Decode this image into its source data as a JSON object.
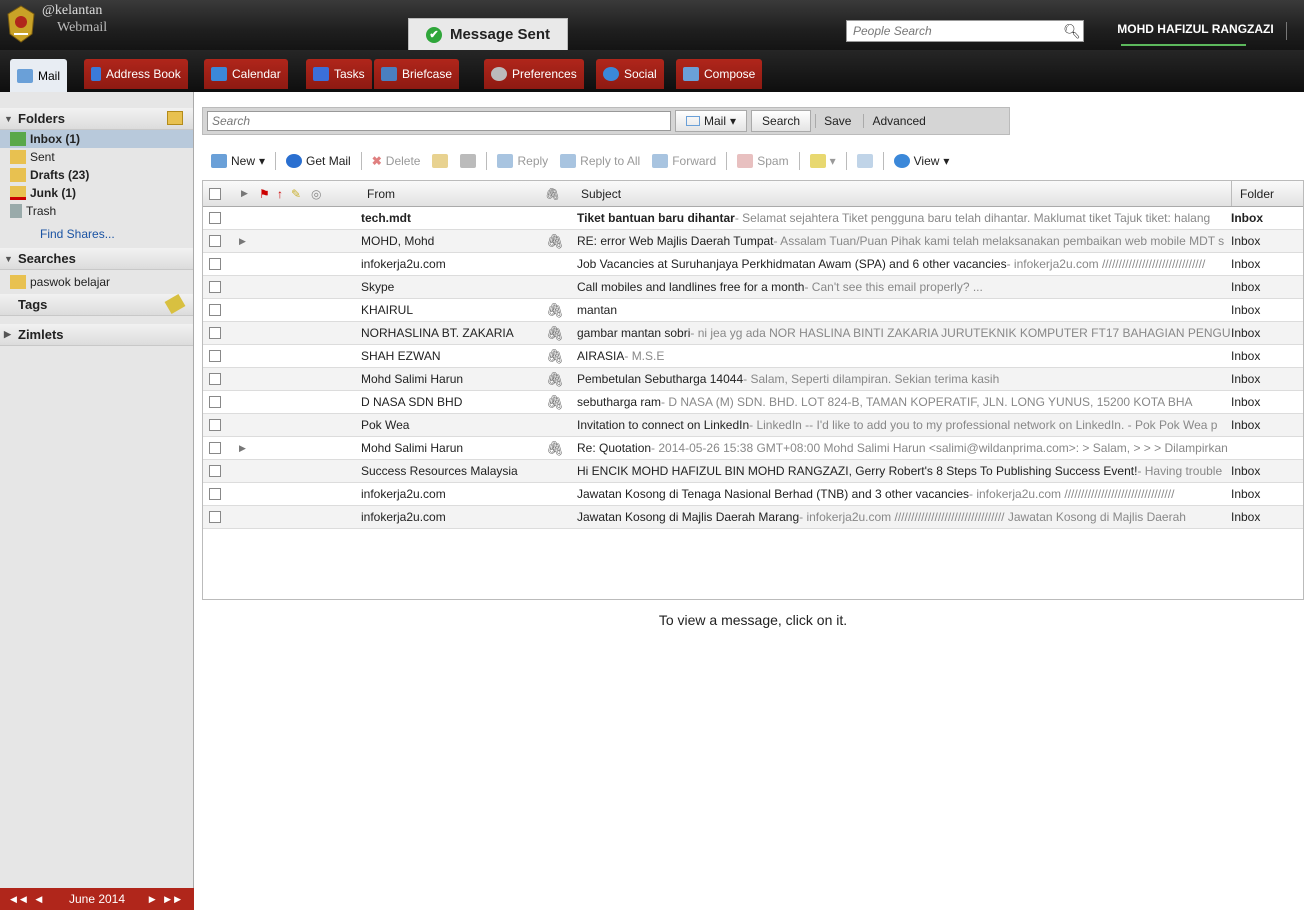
{
  "header": {
    "logo_line1": "@kelantan",
    "logo_line2": "Webmail",
    "toast": "Message Sent",
    "people_search_placeholder": "People Search",
    "user_name": "MOHD HAFIZUL RANGZAZI"
  },
  "tabs": [
    {
      "label": "Mail",
      "icon": "mail-icon",
      "color": "#6aa0d8"
    },
    {
      "label": "Address Book",
      "icon": "address-book-icon",
      "color": "#3b7ad9"
    },
    {
      "label": "Calendar",
      "icon": "calendar-icon",
      "color": "#3b88d9"
    },
    {
      "label": "Tasks",
      "icon": "tasks-icon",
      "color": "#3b6fd9"
    },
    {
      "label": "Briefcase",
      "icon": "briefcase-icon",
      "color": "#4a7fc0"
    },
    {
      "label": "Preferences",
      "icon": "preferences-icon",
      "color": "#bbbbbb"
    },
    {
      "label": "Social",
      "icon": "social-icon",
      "color": "#3b88d9"
    },
    {
      "label": "Compose",
      "icon": "compose-icon",
      "color": "#6aa0d8"
    }
  ],
  "sidebar": {
    "folders_title": "Folders",
    "folders": [
      {
        "label": "Inbox (1)",
        "icon": "inbox-icon",
        "bold": true,
        "selected": true
      },
      {
        "label": "Sent",
        "icon": "sent-icon",
        "bold": false,
        "selected": false
      },
      {
        "label": "Drafts (23)",
        "icon": "drafts-icon",
        "bold": true,
        "selected": false
      },
      {
        "label": "Junk (1)",
        "icon": "junk-icon",
        "bold": true,
        "selected": false
      },
      {
        "label": "Trash",
        "icon": "trash-icon",
        "bold": false,
        "selected": false
      }
    ],
    "find_shares": "Find Shares...",
    "searches_title": "Searches",
    "searches": [
      {
        "label": "paswok belajar"
      }
    ],
    "tags_title": "Tags",
    "zimlets_title": "Zimlets",
    "calendar_month": "June 2014"
  },
  "search": {
    "placeholder": "Search",
    "scope": "Mail",
    "search_btn": "Search",
    "save_btn": "Save",
    "advanced_btn": "Advanced"
  },
  "toolbar": {
    "new": "New",
    "get_mail": "Get Mail",
    "delete": "Delete",
    "reply": "Reply",
    "reply_all": "Reply to All",
    "forward": "Forward",
    "spam": "Spam",
    "view": "View"
  },
  "columns": {
    "from": "From",
    "subject": "Subject",
    "folder": "Folder"
  },
  "messages": [
    {
      "from": "tech.mdt",
      "subject": "Tiket bantuan baru dihantar",
      "fragment": " - Selamat sejahtera Tiket pengguna baru telah dihantar. Maklumat tiket Tajuk tiket: halang",
      "folder": "Inbox",
      "unread": true,
      "attach": false,
      "conv": false
    },
    {
      "from": "MOHD, Mohd",
      "subject": "RE: error Web Majlis Daerah Tumpat",
      "fragment": " - Assalam Tuan/Puan Pihak kami telah melaksanakan pembaikan web mobile MDT s",
      "folder": "Inbox",
      "unread": false,
      "attach": true,
      "conv": true
    },
    {
      "from": "infokerja2u.com",
      "subject": "Job Vacancies at Suruhanjaya Perkhidmatan Awam (SPA) and 6 other vacancies",
      "fragment": " - infokerja2u.com ///////////////////////////////",
      "folder": "Inbox",
      "unread": false,
      "attach": false,
      "conv": false
    },
    {
      "from": "Skype",
      "subject": "Call mobiles and landlines free for a month",
      "fragment": " - Can't see this email properly? ...",
      "folder": "Inbox",
      "unread": false,
      "attach": false,
      "conv": false
    },
    {
      "from": "KHAIRUL",
      "subject": "mantan",
      "fragment": "",
      "folder": "Inbox",
      "unread": false,
      "attach": true,
      "conv": false
    },
    {
      "from": "NORHASLINA BT. ZAKARIA",
      "subject": "gambar mantan sobri",
      "fragment": " - ni jea yg ada NOR HASLINA BINTI ZAKARIA JURUTEKNIK KOMPUTER FT17 BAHAGIAN PENGUR",
      "folder": "Inbox",
      "unread": false,
      "attach": true,
      "conv": false
    },
    {
      "from": "SHAH EZWAN",
      "subject": "AIRASIA",
      "fragment": " - M.S.E",
      "folder": "Inbox",
      "unread": false,
      "attach": true,
      "conv": false
    },
    {
      "from": "Mohd Salimi Harun",
      "subject": "Pembetulan Sebutharga 14044",
      "fragment": " - Salam, Seperti dilampiran. Sekian terima kasih",
      "folder": "Inbox",
      "unread": false,
      "attach": true,
      "conv": false
    },
    {
      "from": "D NASA SDN BHD",
      "subject": "sebutharga ram",
      "fragment": " -       D NASA (M) SDN. BHD. LOT 824-B,  TAMAN KOPERATIF,  JLN. LONG YUNUS,  15200 KOTA BHA",
      "folder": "Inbox",
      "unread": false,
      "attach": true,
      "conv": false
    },
    {
      "from": "Pok Wea",
      "subject": "Invitation to connect on LinkedIn",
      "fragment": " - LinkedIn -- I'd like to add you to my professional network on LinkedIn. - Pok Pok Wea p",
      "folder": "Inbox",
      "unread": false,
      "attach": false,
      "conv": false
    },
    {
      "from": "Mohd Salimi Harun",
      "subject": "Re: Quotation",
      "fragment": " - 2014-05-26 15:38 GMT+08:00 Mohd Salimi Harun <salimi@wildanprima.com>: > Salam, > > > Dilampirkan",
      "folder": "",
      "unread": false,
      "attach": true,
      "conv": true
    },
    {
      "from": "Success Resources Malaysia",
      "subject": "Hi ENCIK MOHD HAFIZUL BIN MOHD RANGZAZI, Gerry Robert's 8 Steps To Publishing Success Event!",
      "fragment": " - Having trouble",
      "folder": "Inbox",
      "unread": false,
      "attach": false,
      "conv": false
    },
    {
      "from": "infokerja2u.com",
      "subject": "Jawatan Kosong di Tenaga Nasional Berhad (TNB) and 3 other vacancies",
      "fragment": " - infokerja2u.com /////////////////////////////////",
      "folder": "Inbox",
      "unread": false,
      "attach": false,
      "conv": false
    },
    {
      "from": "infokerja2u.com",
      "subject": "Jawatan Kosong di Majlis Daerah Marang",
      "fragment": " - infokerja2u.com ///////////////////////////////// Jawatan Kosong di Majlis Daerah",
      "folder": "Inbox",
      "unread": false,
      "attach": false,
      "conv": false
    }
  ],
  "reading_pane": {
    "hint": "To view a message, click on it."
  }
}
